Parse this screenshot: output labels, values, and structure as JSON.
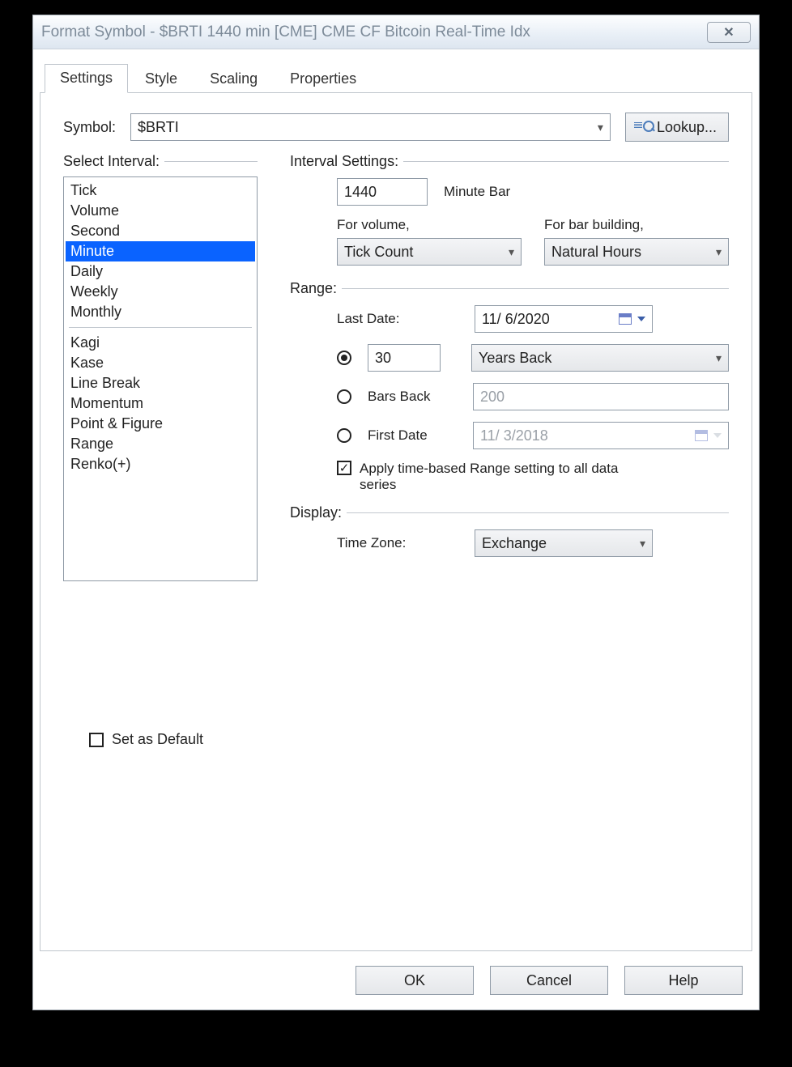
{
  "window": {
    "title": "Format Symbol - $BRTI 1440 min [CME] CME CF Bitcoin Real-Time Idx",
    "close_glyph": "✕"
  },
  "tabs": [
    "Settings",
    "Style",
    "Scaling",
    "Properties"
  ],
  "active_tab": "Settings",
  "symbol": {
    "label": "Symbol:",
    "value": "$BRTI",
    "lookup_label": "Lookup..."
  },
  "select_interval": {
    "label": "Select Interval:",
    "items_top": [
      "Tick",
      "Volume",
      "Second",
      "Minute",
      "Daily",
      "Weekly",
      "Monthly"
    ],
    "items_bottom": [
      "Kagi",
      "Kase",
      "Line Break",
      "Momentum",
      "Point & Figure",
      "Range",
      "Renko(+)"
    ],
    "selected": "Minute"
  },
  "interval_settings": {
    "label": "Interval Settings:",
    "interval_value": "1440",
    "interval_unit": "Minute Bar",
    "for_volume_label": "For volume,",
    "for_volume_value": "Tick Count",
    "for_bar_label": "For bar building,",
    "for_bar_value": "Natural Hours"
  },
  "range": {
    "label": "Range:",
    "last_date_label": "Last Date:",
    "last_date_value": "11/ 6/2020",
    "option_back": {
      "value": "30",
      "unit": "Years Back"
    },
    "option_bars_back": {
      "label": "Bars Back",
      "value": "200"
    },
    "option_first_date": {
      "label": "First Date",
      "value": "11/ 3/2018"
    },
    "selected_option": "back",
    "apply_all_checked": true,
    "apply_all_label": "Apply time-based Range setting to all data series"
  },
  "display": {
    "label": "Display:",
    "timezone_label": "Time Zone:",
    "timezone_value": "Exchange"
  },
  "set_as_default": {
    "checked": false,
    "label": "Set as Default"
  },
  "buttons": {
    "ok": "OK",
    "cancel": "Cancel",
    "help": "Help"
  }
}
